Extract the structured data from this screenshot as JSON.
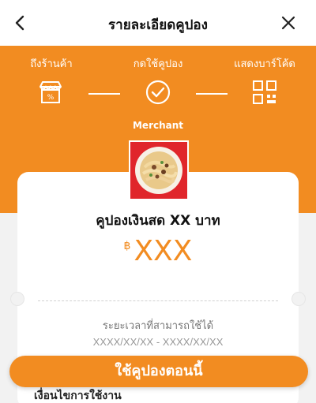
{
  "header": {
    "title": "รายละเอียดคูปอง",
    "back_icon": "chevron-left-icon",
    "close_icon": "close-icon"
  },
  "steps": [
    {
      "label": "ถึงร้านค้า",
      "icon": "store-icon"
    },
    {
      "label": "กดใช้คูปอง",
      "icon": "check-circle-icon"
    },
    {
      "label": "แสดงบาร์โค้ด",
      "icon": "qr-code-icon"
    }
  ],
  "merchant": {
    "name": "Merchant"
  },
  "coupon": {
    "title": "คูปองเงินสด XX บาท",
    "currency": "฿",
    "amount": "XXX",
    "period_label": "ระยะเวลาที่สามารถใช้ได้",
    "period_value": "XXXX/XX/XX - XXXX/XX/XX"
  },
  "actions": {
    "use_now": "ใช้คูปองตอนนี้"
  },
  "conditions": {
    "title": "เงื่อนไขการใช้งาน"
  },
  "colors": {
    "accent": "#f28c21",
    "thumb_bg": "#e0262b"
  }
}
